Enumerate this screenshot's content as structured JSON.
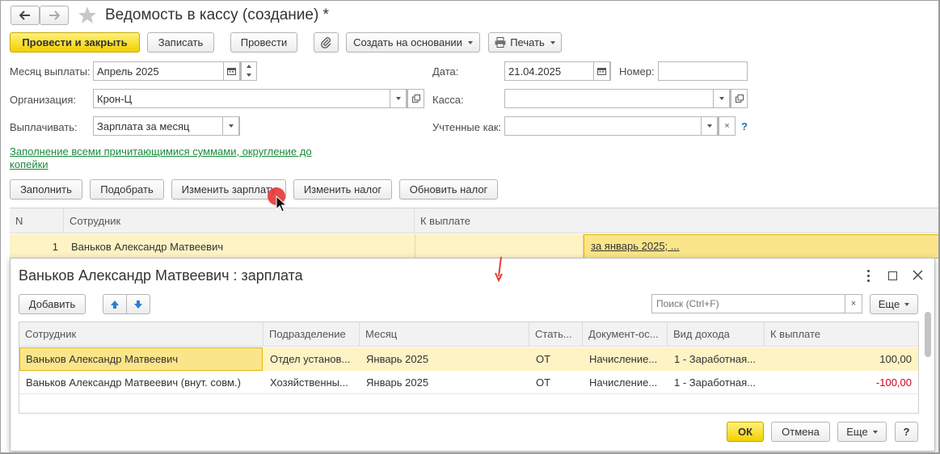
{
  "window": {
    "title": "Ведомость в кассу (создание) *"
  },
  "toolbar": {
    "post_close": "Провести и закрыть",
    "save": "Записать",
    "post": "Провести",
    "create_based": "Создать на основании",
    "print": "Печать"
  },
  "form": {
    "month_label": "Месяц выплаты:",
    "month_value": "Апрель 2025",
    "date_label": "Дата:",
    "date_value": "21.04.2025",
    "number_label": "Номер:",
    "number_value": "",
    "org_label": "Организация:",
    "org_value": "Крон-Ц",
    "cash_label": "Касса:",
    "cash_value": "",
    "pay_label": "Выплачивать:",
    "pay_value": "Зарплата за месяц",
    "counted_label": "Учтенные как:",
    "counted_value": "",
    "help": "?",
    "fill_link": "Заполнение всеми причитающимися суммами, округление до копейки"
  },
  "actions": {
    "fill": "Заполнить",
    "pick": "Подобрать",
    "change_salary": "Изменить зарплату",
    "change_tax": "Изменить налог",
    "update_tax": "Обновить налог"
  },
  "main_table": {
    "headers": [
      "N",
      "Сотрудник",
      "К выплате"
    ],
    "rows": [
      {
        "n": "1",
        "employee": "Ваньков Александр Матвеевич",
        "amount": "",
        "detail": "за январь 2025; ..."
      }
    ]
  },
  "dialog": {
    "title": "Ваньков Александр Матвеевич : зарплата",
    "add": "Добавить",
    "search_placeholder": "Поиск (Ctrl+F)",
    "more": "Еще",
    "headers": [
      "Сотрудник",
      "Подразделение",
      "Месяц",
      "Стать...",
      "Документ-ос...",
      "Вид дохода",
      "К выплате"
    ],
    "rows": [
      {
        "employee": "Ваньков Александр Матвеевич",
        "dept": "Отдел установ...",
        "month": "Январь 2025",
        "article": "ОТ",
        "doc": "Начисление...",
        "income": "1 - Заработная...",
        "amount": "100,00"
      },
      {
        "employee": "Ваньков Александр Матвеевич (внут. совм.)",
        "dept": "Хозяйственны...",
        "month": "Январь 2025",
        "article": "ОТ",
        "doc": "Начисление...",
        "income": "1 - Заработная...",
        "amount": "-100,00"
      }
    ],
    "ok": "ОК",
    "cancel": "Отмена",
    "more2": "Еще",
    "help": "?"
  },
  "colors": {
    "accent_yellow": "#f2d000",
    "selected_row": "#fdf3c4",
    "link_green": "#1a8a3c",
    "negative_red": "#d0021b"
  }
}
